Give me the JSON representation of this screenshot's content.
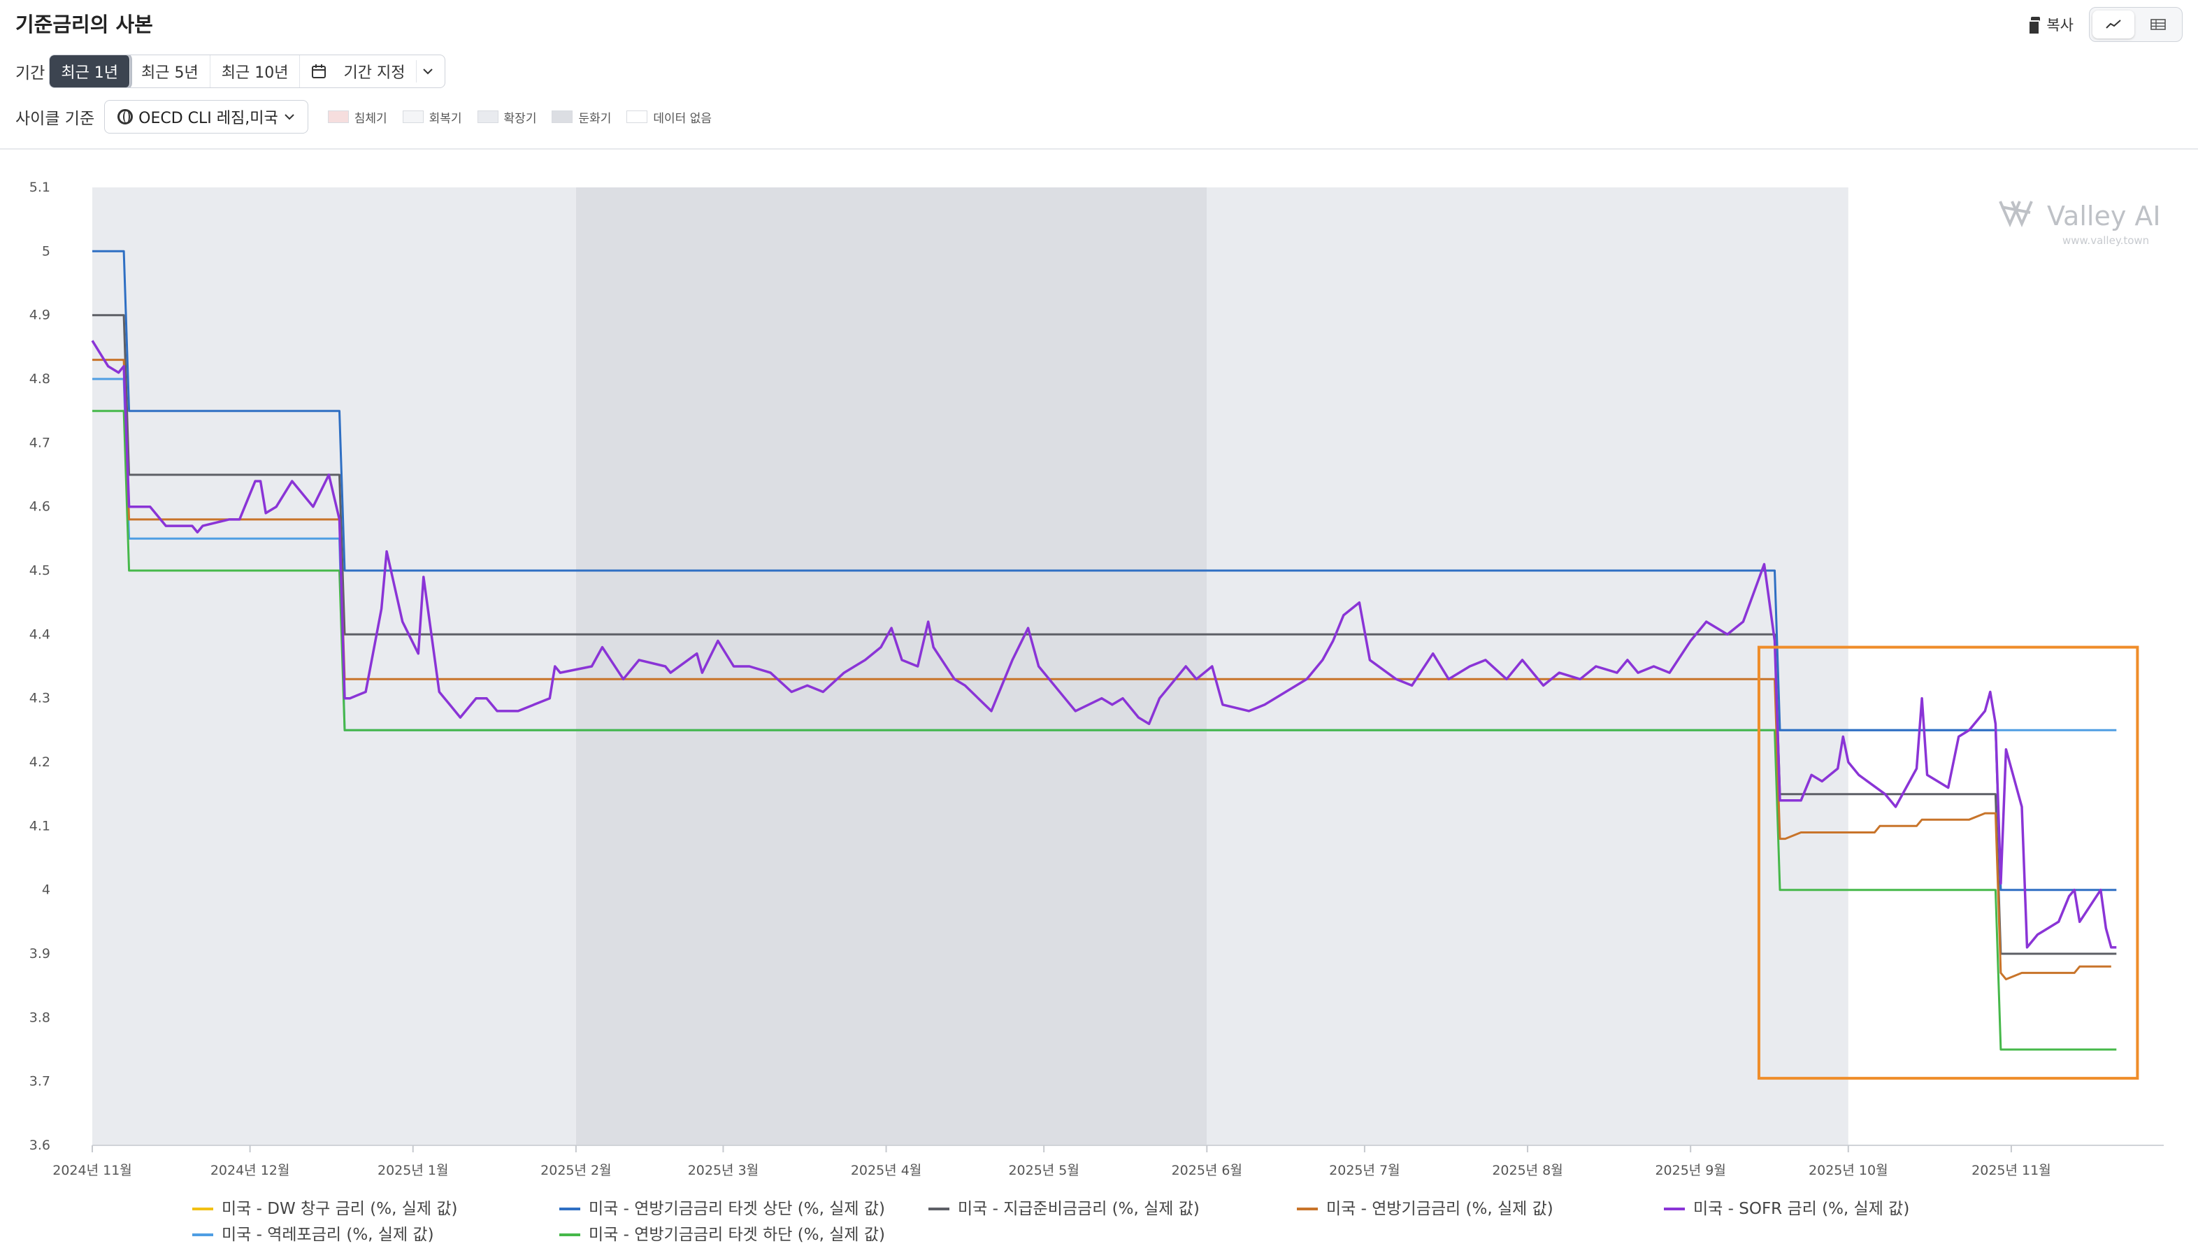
{
  "header": {
    "title": "기준금리의 사본",
    "copy_label": "복사"
  },
  "period": {
    "label": "기간",
    "options": [
      "최근 1년",
      "최근 5년",
      "최근 10년"
    ],
    "selected": "최근 1년",
    "custom_label": "기간 지정"
  },
  "cycle": {
    "label": "사이클 기준",
    "value": "OECD CLI 레짐,미국",
    "phases": [
      {
        "label": "침체기",
        "color": "#f6dede"
      },
      {
        "label": "회복기",
        "color": "#f4f5f7"
      },
      {
        "label": "확장기",
        "color": "#e9ebef"
      },
      {
        "label": "둔화기",
        "color": "#dcdee3"
      },
      {
        "label": "데이터 없음",
        "color": "#ffffff"
      }
    ]
  },
  "watermark": {
    "brand": "Valley AI",
    "url": "www.valley.town"
  },
  "chart_data": {
    "type": "line",
    "ylim": [
      3.6,
      5.1
    ],
    "yticks": [
      "5.1",
      "5",
      "4.9",
      "4.8",
      "4.7",
      "4.6",
      "4.5",
      "4.4",
      "4.3",
      "4.2",
      "4.1",
      "4",
      "3.9",
      "3.8",
      "3.7",
      "3.6"
    ],
    "xticks": [
      "2024년 11월",
      "2024년 12월",
      "2025년 1월",
      "2025년 2월",
      "2025년 3월",
      "2025년 4월",
      "2025년 5월",
      "2025년 6월",
      "2025년 7월",
      "2025년 8월",
      "2025년 9월",
      "2025년 10월",
      "2025년 11월"
    ],
    "xrange": [
      "2024-11-01",
      "2025-11-30"
    ],
    "regimes": [
      {
        "start": "2024-11-01",
        "end": "2025-02-01",
        "phase": "확장기"
      },
      {
        "start": "2025-02-01",
        "end": "2025-06-01",
        "phase": "둔화기"
      },
      {
        "start": "2025-06-01",
        "end": "2025-10-01",
        "phase": "확장기"
      }
    ],
    "series": [
      {
        "name": "미국 - DW 창구 금리 (%, 실제 값)",
        "color": "#f2c014",
        "points": []
      },
      {
        "name": "미국 - 연방기금금리 타겟 상단 (%, 실제 값)",
        "color": "#2f6fc3",
        "points": [
          [
            "2024-11-01",
            5.0
          ],
          [
            "2024-11-07",
            5.0
          ],
          [
            "2024-11-08",
            4.75
          ],
          [
            "2024-12-18",
            4.75
          ],
          [
            "2024-12-19",
            4.5
          ],
          [
            "2025-09-17",
            4.5
          ],
          [
            "2025-09-18",
            4.25
          ],
          [
            "2025-10-29",
            4.25
          ],
          [
            "2025-10-30",
            4.0
          ],
          [
            "2025-11-21",
            4.0
          ]
        ]
      },
      {
        "name": "미국 - 지급준비금금리 (%, 실제 값)",
        "color": "#5d5f66",
        "points": [
          [
            "2024-11-01",
            4.9
          ],
          [
            "2024-11-07",
            4.9
          ],
          [
            "2024-11-08",
            4.65
          ],
          [
            "2024-12-18",
            4.65
          ],
          [
            "2024-12-19",
            4.4
          ],
          [
            "2025-09-17",
            4.4
          ],
          [
            "2025-09-18",
            4.15
          ],
          [
            "2025-10-29",
            4.15
          ],
          [
            "2025-10-30",
            3.9
          ],
          [
            "2025-11-21",
            3.9
          ]
        ]
      },
      {
        "name": "미국 - 연방기금금리 (%, 실제 값)",
        "color": "#c8742a",
        "points": [
          [
            "2024-11-01",
            4.83
          ],
          [
            "2024-11-07",
            4.83
          ],
          [
            "2024-11-08",
            4.58
          ],
          [
            "2024-12-18",
            4.58
          ],
          [
            "2024-12-19",
            4.33
          ],
          [
            "2025-09-17",
            4.33
          ],
          [
            "2025-09-18",
            4.08
          ],
          [
            "2025-09-19",
            4.08
          ],
          [
            "2025-09-22",
            4.09
          ],
          [
            "2025-10-06",
            4.09
          ],
          [
            "2025-10-07",
            4.1
          ],
          [
            "2025-10-14",
            4.1
          ],
          [
            "2025-10-15",
            4.11
          ],
          [
            "2025-10-24",
            4.11
          ],
          [
            "2025-10-27",
            4.12
          ],
          [
            "2025-10-29",
            4.12
          ],
          [
            "2025-10-30",
            3.87
          ],
          [
            "2025-10-31",
            3.86
          ],
          [
            "2025-11-03",
            3.87
          ],
          [
            "2025-11-13",
            3.87
          ],
          [
            "2025-11-14",
            3.88
          ],
          [
            "2025-11-20",
            3.88
          ]
        ]
      },
      {
        "name": "미국 - SOFR 금리 (%, 실제 값)",
        "color": "#8a34d6",
        "points": [
          [
            "2024-11-01",
            4.86
          ],
          [
            "2024-11-04",
            4.82
          ],
          [
            "2024-11-06",
            4.81
          ],
          [
            "2024-11-07",
            4.82
          ],
          [
            "2024-11-08",
            4.6
          ],
          [
            "2024-11-12",
            4.6
          ],
          [
            "2024-11-15",
            4.57
          ],
          [
            "2024-11-20",
            4.57
          ],
          [
            "2024-11-21",
            4.56
          ],
          [
            "2024-11-22",
            4.57
          ],
          [
            "2024-11-27",
            4.58
          ],
          [
            "2024-11-29",
            4.58
          ],
          [
            "2024-12-02",
            4.64
          ],
          [
            "2024-12-03",
            4.64
          ],
          [
            "2024-12-04",
            4.59
          ],
          [
            "2024-12-06",
            4.6
          ],
          [
            "2024-12-09",
            4.64
          ],
          [
            "2024-12-11",
            4.62
          ],
          [
            "2024-12-13",
            4.6
          ],
          [
            "2024-12-16",
            4.65
          ],
          [
            "2024-12-18",
            4.58
          ],
          [
            "2024-12-19",
            4.3
          ],
          [
            "2024-12-20",
            4.3
          ],
          [
            "2024-12-23",
            4.31
          ],
          [
            "2024-12-26",
            4.44
          ],
          [
            "2024-12-27",
            4.53
          ],
          [
            "2024-12-30",
            4.42
          ],
          [
            "2025-01-02",
            4.37
          ],
          [
            "2025-01-03",
            4.49
          ],
          [
            "2025-01-06",
            4.31
          ],
          [
            "2025-01-07",
            4.3
          ],
          [
            "2025-01-08",
            4.29
          ],
          [
            "2025-01-10",
            4.27
          ],
          [
            "2025-01-13",
            4.3
          ],
          [
            "2025-01-15",
            4.3
          ],
          [
            "2025-01-17",
            4.28
          ],
          [
            "2025-01-21",
            4.28
          ],
          [
            "2025-01-24",
            4.29
          ],
          [
            "2025-01-27",
            4.3
          ],
          [
            "2025-01-28",
            4.35
          ],
          [
            "2025-01-29",
            4.34
          ],
          [
            "2025-02-04",
            4.35
          ],
          [
            "2025-02-06",
            4.38
          ],
          [
            "2025-02-10",
            4.33
          ],
          [
            "2025-02-13",
            4.36
          ],
          [
            "2025-02-18",
            4.35
          ],
          [
            "2025-02-19",
            4.34
          ],
          [
            "2025-02-24",
            4.37
          ],
          [
            "2025-02-25",
            4.34
          ],
          [
            "2025-02-28",
            4.39
          ],
          [
            "2025-03-03",
            4.35
          ],
          [
            "2025-03-06",
            4.35
          ],
          [
            "2025-03-10",
            4.34
          ],
          [
            "2025-03-14",
            4.31
          ],
          [
            "2025-03-17",
            4.32
          ],
          [
            "2025-03-20",
            4.31
          ],
          [
            "2025-03-24",
            4.34
          ],
          [
            "2025-03-26",
            4.35
          ],
          [
            "2025-03-28",
            4.36
          ],
          [
            "2025-03-31",
            4.38
          ],
          [
            "2025-04-02",
            4.41
          ],
          [
            "2025-04-04",
            4.36
          ],
          [
            "2025-04-07",
            4.35
          ],
          [
            "2025-04-09",
            4.42
          ],
          [
            "2025-04-10",
            4.38
          ],
          [
            "2025-04-14",
            4.33
          ],
          [
            "2025-04-16",
            4.32
          ],
          [
            "2025-04-21",
            4.28
          ],
          [
            "2025-04-23",
            4.32
          ],
          [
            "2025-04-25",
            4.36
          ],
          [
            "2025-04-28",
            4.41
          ],
          [
            "2025-04-30",
            4.35
          ],
          [
            "2025-05-05",
            4.3
          ],
          [
            "2025-05-07",
            4.28
          ],
          [
            "2025-05-12",
            4.3
          ],
          [
            "2025-05-14",
            4.29
          ],
          [
            "2025-05-16",
            4.3
          ],
          [
            "2025-05-19",
            4.27
          ],
          [
            "2025-05-21",
            4.26
          ],
          [
            "2025-05-23",
            4.3
          ],
          [
            "2025-05-28",
            4.35
          ],
          [
            "2025-05-30",
            4.33
          ],
          [
            "2025-06-02",
            4.35
          ],
          [
            "2025-06-04",
            4.29
          ],
          [
            "2025-06-09",
            4.28
          ],
          [
            "2025-06-12",
            4.29
          ],
          [
            "2025-06-16",
            4.31
          ],
          [
            "2025-06-20",
            4.33
          ],
          [
            "2025-06-23",
            4.36
          ],
          [
            "2025-06-25",
            4.39
          ],
          [
            "2025-06-27",
            4.43
          ],
          [
            "2025-06-30",
            4.45
          ],
          [
            "2025-07-02",
            4.36
          ],
          [
            "2025-07-07",
            4.33
          ],
          [
            "2025-07-10",
            4.32
          ],
          [
            "2025-07-14",
            4.37
          ],
          [
            "2025-07-17",
            4.33
          ],
          [
            "2025-07-21",
            4.35
          ],
          [
            "2025-07-24",
            4.36
          ],
          [
            "2025-07-28",
            4.33
          ],
          [
            "2025-07-31",
            4.36
          ],
          [
            "2025-08-04",
            4.32
          ],
          [
            "2025-08-07",
            4.34
          ],
          [
            "2025-08-11",
            4.33
          ],
          [
            "2025-08-14",
            4.35
          ],
          [
            "2025-08-18",
            4.34
          ],
          [
            "2025-08-20",
            4.36
          ],
          [
            "2025-08-22",
            4.34
          ],
          [
            "2025-08-25",
            4.35
          ],
          [
            "2025-08-28",
            4.34
          ],
          [
            "2025-09-01",
            4.39
          ],
          [
            "2025-09-04",
            4.42
          ],
          [
            "2025-09-08",
            4.4
          ],
          [
            "2025-09-11",
            4.42
          ],
          [
            "2025-09-15",
            4.51
          ],
          [
            "2025-09-17",
            4.39
          ],
          [
            "2025-09-18",
            4.14
          ],
          [
            "2025-09-22",
            4.14
          ],
          [
            "2025-09-24",
            4.18
          ],
          [
            "2025-09-26",
            4.17
          ],
          [
            "2025-09-29",
            4.19
          ],
          [
            "2025-09-30",
            4.24
          ],
          [
            "2025-10-01",
            4.2
          ],
          [
            "2025-10-03",
            4.18
          ],
          [
            "2025-10-08",
            4.15
          ],
          [
            "2025-10-10",
            4.13
          ],
          [
            "2025-10-14",
            4.19
          ],
          [
            "2025-10-15",
            4.3
          ],
          [
            "2025-10-16",
            4.18
          ],
          [
            "2025-10-20",
            4.16
          ],
          [
            "2025-10-22",
            4.24
          ],
          [
            "2025-10-24",
            4.25
          ],
          [
            "2025-10-27",
            4.28
          ],
          [
            "2025-10-28",
            4.31
          ],
          [
            "2025-10-29",
            4.26
          ],
          [
            "2025-10-30",
            4.01
          ],
          [
            "2025-10-31",
            4.22
          ],
          [
            "2025-11-03",
            4.13
          ],
          [
            "2025-11-04",
            3.91
          ],
          [
            "2025-11-06",
            3.93
          ],
          [
            "2025-11-10",
            3.95
          ],
          [
            "2025-11-12",
            3.99
          ],
          [
            "2025-11-13",
            4.0
          ],
          [
            "2025-11-14",
            3.95
          ],
          [
            "2025-11-18",
            4.0
          ],
          [
            "2025-11-19",
            3.94
          ],
          [
            "2025-11-20",
            3.91
          ],
          [
            "2025-11-21",
            3.91
          ]
        ]
      },
      {
        "name": "미국 - 역레포금리 (%, 실제 값)",
        "color": "#4f9ee3",
        "points": [
          [
            "2024-11-01",
            4.8
          ],
          [
            "2024-11-07",
            4.8
          ],
          [
            "2024-11-08",
            4.55
          ],
          [
            "2024-12-18",
            4.55
          ],
          [
            "2024-12-19",
            4.25
          ],
          [
            "2025-11-21",
            4.25
          ]
        ]
      },
      {
        "name": "미국 - 연방기금금리 타겟 하단 (%, 실제 값)",
        "color": "#46b84a",
        "points": [
          [
            "2024-11-01",
            4.75
          ],
          [
            "2024-11-07",
            4.75
          ],
          [
            "2024-11-08",
            4.5
          ],
          [
            "2024-12-18",
            4.5
          ],
          [
            "2024-12-19",
            4.25
          ],
          [
            "2025-09-17",
            4.25
          ],
          [
            "2025-09-18",
            4.0
          ],
          [
            "2025-10-29",
            4.0
          ],
          [
            "2025-10-30",
            3.75
          ],
          [
            "2025-11-21",
            3.75
          ]
        ]
      }
    ],
    "highlight": {
      "start": "2025-09-14",
      "end": "2025-11-25",
      "ymin": 3.705,
      "ymax": 4.38,
      "color": "#ef8d2a"
    }
  }
}
